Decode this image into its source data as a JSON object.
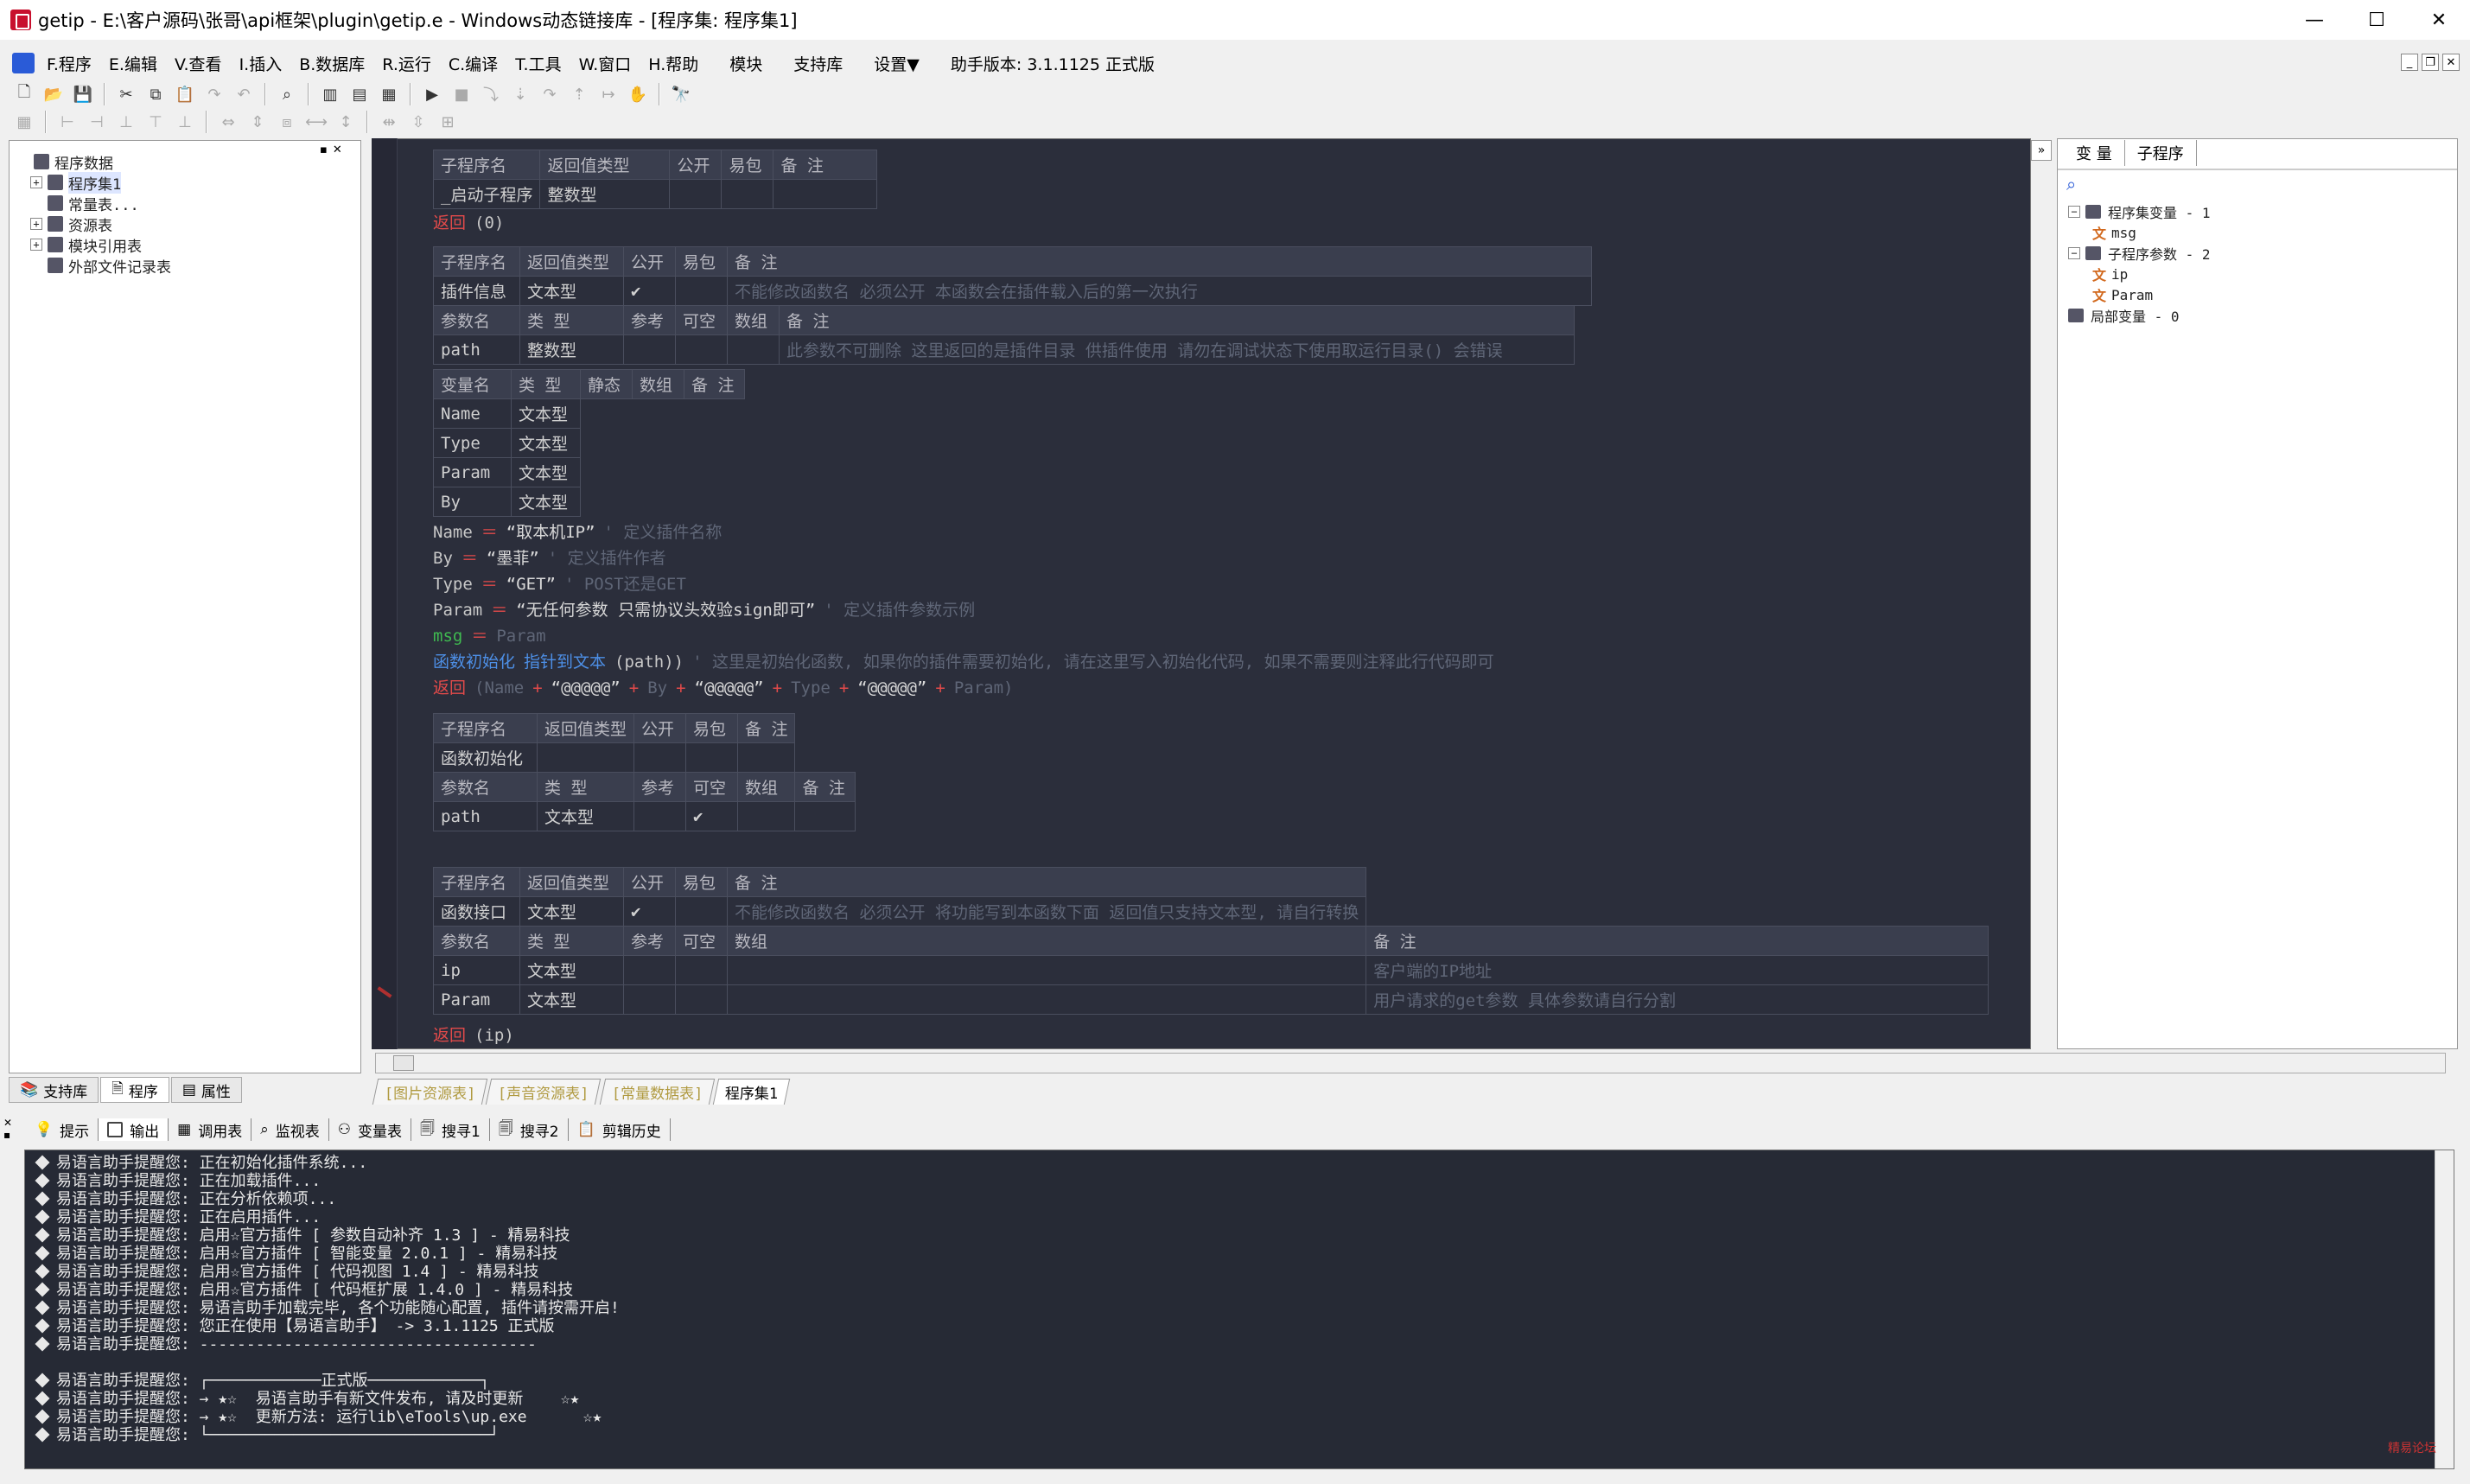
{
  "window": {
    "title": "getip - E:\\客户源码\\张哥\\api框架\\plugin\\getip.e - Windows动态链接库 - [程序集: 程序集1]",
    "minimize": "—",
    "maximize": "☐",
    "close": "✕"
  },
  "menu": {
    "items": [
      "F.程序",
      "E.编辑",
      "V.查看",
      "I.插入",
      "B.数据库",
      "R.运行",
      "C.编译",
      "T.工具",
      "W.窗口",
      "H.帮助",
      "模块",
      "支持库",
      "设置▼",
      "助手版本: 3.1.1125 正式版"
    ]
  },
  "left_panel": {
    "tree": [
      {
        "label": "程序数据",
        "level": 0,
        "expander": ""
      },
      {
        "label": "程序集1",
        "level": 1,
        "expander": "+",
        "selected": true
      },
      {
        "label": "常量表...",
        "level": 1,
        "expander": ""
      },
      {
        "label": "资源表",
        "level": 1,
        "expander": "+"
      },
      {
        "label": "模块引用表",
        "level": 1,
        "expander": "+"
      },
      {
        "label": "外部文件记录表",
        "level": 1,
        "expander": ""
      }
    ],
    "tabs": [
      "支持库",
      "程序",
      "属性"
    ]
  },
  "editor": {
    "startup_table": {
      "header": [
        "子程序名",
        "返回值类型",
        "公开",
        "易包",
        "备 注"
      ],
      "row": [
        "_启动子程序",
        "整数型",
        "",
        "",
        ""
      ]
    },
    "return0": {
      "kw": "返回",
      "rest": "(0)"
    },
    "plugin_info_table": {
      "header": [
        "子程序名",
        "返回值类型",
        "公开",
        "易包",
        "备 注"
      ],
      "row": [
        "插件信息",
        "文本型",
        "✔",
        "",
        "不能修改函数名 必须公开 本函数会在插件载入后的第一次执行"
      ],
      "param_header": [
        "参数名",
        "类 型",
        "参考",
        "可空",
        "数组",
        "备 注"
      ],
      "param_row": [
        "path",
        "整数型",
        "",
        "",
        "",
        "此参数不可删除 这里返回的是插件目录 供插件使用 请勿在调试状态下使用取运行目录() 会错误"
      ]
    },
    "var_table": {
      "header": [
        "变量名",
        "类 型",
        "静态",
        "数组",
        "备 注"
      ],
      "rows": [
        [
          "Name",
          "文本型"
        ],
        [
          "Type",
          "文本型"
        ],
        [
          "Param",
          "文本型"
        ],
        [
          "By",
          "文本型"
        ]
      ]
    },
    "lines": [
      {
        "var": "Name",
        "op": "＝",
        "val": "“取本机IP”",
        "cm": "' 定义插件名称"
      },
      {
        "var": "By",
        "op": "＝",
        "val": "“墨菲”",
        "cm": "' 定义插件作者"
      },
      {
        "var": "Type",
        "op": "＝",
        "val": "“GET”",
        "cm": "' POST还是GET"
      },
      {
        "var": "Param",
        "op": "＝",
        "val": "“无任何参数 只需协议头效验sign即可”",
        "cm": "' 定义插件参数示例"
      }
    ],
    "msg_line": {
      "var": "msg",
      "op": "＝",
      "val": "Param"
    },
    "init_line": {
      "fn": "函数初始化",
      "inner": "指针到文本",
      "arg": "(path))",
      "cm": "' 这里是初始化函数, 如果你的插件需要初始化, 请在这里写入初始化代码, 如果不需要则注释此行代码即可"
    },
    "return_line": {
      "kw": "返回",
      "p1": "(Name",
      "p2": "“@@@@@”",
      "p3": "By",
      "p4": "“@@@@@”",
      "p5": "Type",
      "p6": "“@@@@@”",
      "p7": "Param)"
    },
    "init_table": {
      "header": [
        "子程序名",
        "返回值类型",
        "公开",
        "易包",
        "备 注"
      ],
      "row": [
        "函数初始化",
        "",
        "",
        "",
        ""
      ],
      "param_header": [
        "参数名",
        "类 型",
        "参考",
        "可空",
        "数组",
        "备 注"
      ],
      "param_row": [
        "path",
        "文本型",
        "",
        "✔",
        "",
        ""
      ]
    },
    "api_table": {
      "header": [
        "子程序名",
        "返回值类型",
        "公开",
        "易包",
        "备 注"
      ],
      "row": [
        "函数接口",
        "文本型",
        "✔",
        "",
        "不能修改函数名 必须公开 将功能写到本函数下面 返回值只支持文本型, 请自行转换"
      ],
      "param_header": [
        "参数名",
        "类 型",
        "参考",
        "可空",
        "数组",
        "备 注"
      ],
      "param_rows": [
        [
          "ip",
          "文本型",
          "",
          "",
          "",
          "客户端的IP地址"
        ],
        [
          "Param",
          "文本型",
          "",
          "",
          "",
          "用户请求的get参数 具体参数请自行分割"
        ]
      ]
    },
    "return_ip": {
      "kw": "返回",
      "rest": "(ip)"
    },
    "tabs": [
      "[图片资源表]",
      "[声音资源表]",
      "[常量数据表]",
      "程序集1"
    ]
  },
  "right_panel": {
    "tabs": [
      "变 量",
      "子程序"
    ],
    "tree": [
      {
        "label": "程序集变量 - 1",
        "level": 0,
        "expander": "−"
      },
      {
        "label": "msg",
        "level": 1,
        "wen": true
      },
      {
        "label": "子程序参数 - 2",
        "level": 0,
        "expander": "−"
      },
      {
        "label": "ip",
        "level": 1,
        "wen": true
      },
      {
        "label": "Param",
        "level": 1,
        "wen": true
      },
      {
        "label": "局部变量 - 0",
        "level": 0,
        "expander": ""
      }
    ]
  },
  "bottom": {
    "tabs": [
      "提示",
      "输出",
      "调用表",
      "监视表",
      "变量表",
      "搜寻1",
      "搜寻2",
      "剪辑历史"
    ],
    "output_lines": [
      "易语言助手提醒您: 正在初始化插件系统...",
      "易语言助手提醒您: 正在加载插件...",
      "易语言助手提醒您: 正在分析依赖项...",
      "易语言助手提醒您: 正在启用插件...",
      "易语言助手提醒您: 启用☆官方插件 [ 参数自动补齐 1.3 ] - 精易科技",
      "易语言助手提醒您: 启用☆官方插件 [ 智能变量 2.0.1 ] - 精易科技",
      "易语言助手提醒您: 启用☆官方插件 [ 代码视图 1.4 ] - 精易科技",
      "易语言助手提醒您: 启用☆官方插件 [ 代码框扩展 1.4.0 ] - 精易科技",
      "易语言助手提醒您: 易语言助手加载完毕, 各个功能随心配置, 插件请按需开启!",
      "易语言助手提醒您: 您正在使用【易语言助手】 -> 3.1.1125 正式版",
      "易语言助手提醒您: ------------------------------------",
      "",
      "易语言助手提醒您: ┌────────────正式版────────────┐",
      "易语言助手提醒您: → ★☆  易语言助手有新文件发布, 请及时更新    ☆★",
      "易语言助手提醒您: → ★☆  更新方法: 运行lib\\eTools\\up.exe      ☆★",
      "易语言助手提醒您: └──────────────────────────────┘"
    ],
    "watermark": "精易论坛"
  }
}
